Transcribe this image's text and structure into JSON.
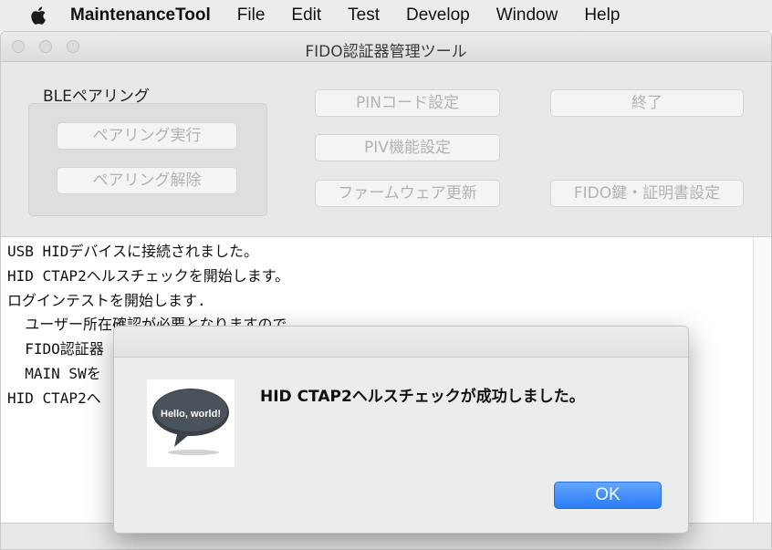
{
  "menubar": {
    "app_name": "MaintenanceTool",
    "items": [
      "File",
      "Edit",
      "Test",
      "Develop",
      "Window",
      "Help"
    ]
  },
  "window": {
    "title": "FIDO認証器管理ツール"
  },
  "ble_group": {
    "label": "BLEペアリング",
    "pair_button": "ペアリング実行",
    "unpair_button": "ペアリング解除"
  },
  "buttons": {
    "pin_code": "PINコード設定",
    "piv": "PIV機能設定",
    "firmware": "ファームウェア更新",
    "quit": "終了",
    "fido_key": "FIDO鍵・証明書設定"
  },
  "log": {
    "lines": [
      "USB HIDデバイスに接続されました。",
      "HID CTAP2ヘルスチェックを開始します。",
      "ログインテストを開始します.",
      "  ユーザー所在確認が必要となりますので、",
      "  FIDO認証器",
      "  MAIN SWを",
      "HID CTAP2へ"
    ]
  },
  "alert": {
    "icon_text": "Hello, world!",
    "message": "HID CTAP2ヘルスチェックが成功しました。",
    "ok_label": "OK"
  },
  "colors": {
    "accent_button": "#2a7bf5",
    "disabled_text": "#b3b3b3"
  }
}
